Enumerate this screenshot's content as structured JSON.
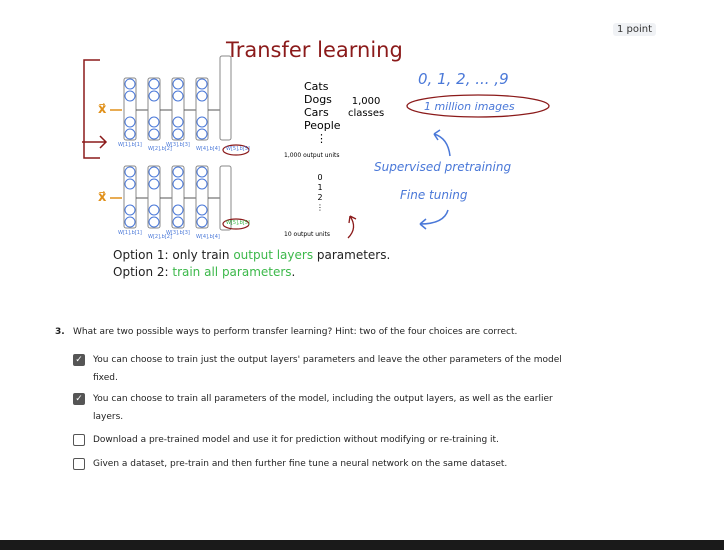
{
  "points_badge": "1 point",
  "slide": {
    "title": "Transfer learning",
    "input_label": "x⃗",
    "classes_top": [
      "Cats",
      "Dogs",
      "Cars",
      "People",
      "⋮"
    ],
    "class_count": "1,000",
    "class_word": "classes",
    "output_top": "1,000 output units",
    "classes_bottom": [
      "0",
      "1",
      "2",
      "⋮"
    ],
    "output_bottom": "10 output units",
    "weights": [
      "W[1],b[1]",
      "W[2],b[2]",
      "W[3],b[3]",
      "W[4],b[4]",
      "W[5],b[5]"
    ],
    "digits": "0, 1, 2, ... ,9",
    "million": "1 million images",
    "supervised": "Supervised pretraining",
    "fine": "Fine tuning",
    "option1_a": "Option 1: only train ",
    "option1_b": "output layers",
    "option1_c": " parameters.",
    "option2_a": "Option 2: ",
    "option2_b": "train all parameters",
    "option2_c": "."
  },
  "question": {
    "number": "3.",
    "text": "What are two possible ways to perform transfer learning? Hint: two of the four choices are correct.",
    "options": [
      {
        "label": "You can choose to train just the output layers' parameters and leave the other parameters of the model fixed.",
        "checked": true
      },
      {
        "label": "You can choose to train all parameters of the model, including the output layers, as well as the earlier layers.",
        "checked": true
      },
      {
        "label": "Download a pre-trained model and use it for prediction without modifying or re-training it.",
        "checked": false
      },
      {
        "label": "Given a dataset, pre-train and then further fine tune a neural network on the same dataset.",
        "checked": false
      }
    ]
  }
}
